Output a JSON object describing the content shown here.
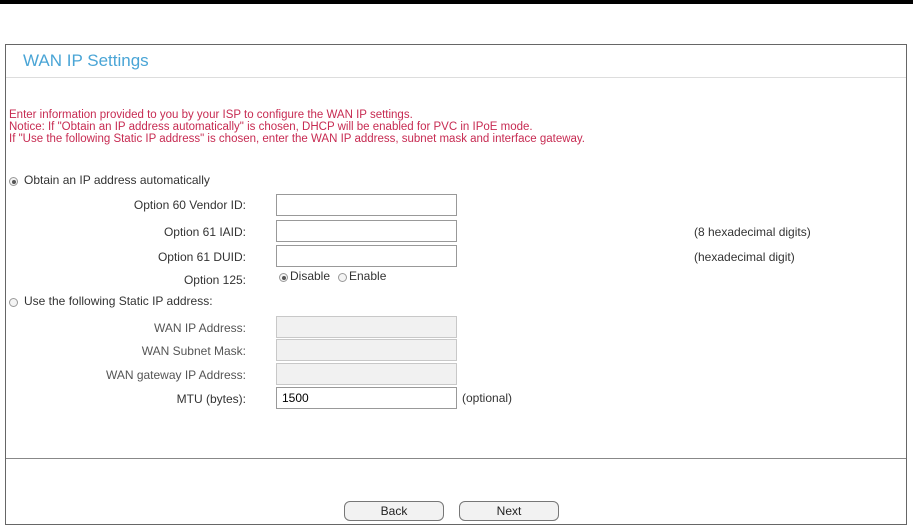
{
  "page": {
    "title": "WAN IP Settings"
  },
  "notice": {
    "line1": "Enter information provided to you by your ISP to configure the WAN IP settings.",
    "line2": "Notice: If \"Obtain an IP address automatically\" is chosen, DHCP will be enabled for PVC in IPoE mode.",
    "line3": "If \"Use the following Static IP address\" is chosen, enter the WAN IP address, subnet mask and interface gateway."
  },
  "mode": {
    "auto_label": "Obtain an IP address automatically",
    "auto_selected": true,
    "static_label": "Use the following Static IP address:",
    "static_selected": false
  },
  "auto_fields": {
    "option60_label": "Option 60 Vendor ID:",
    "option60_value": "",
    "option61_iaid_label": "Option 61 IAID:",
    "option61_iaid_value": "",
    "option61_iaid_hint": "(8 hexadecimal digits)",
    "option61_duid_label": "Option 61 DUID:",
    "option61_duid_value": "",
    "option61_duid_hint": "(hexadecimal digit)",
    "option125_label": "Option 125:",
    "option125_disable": "Disable",
    "option125_enable": "Enable",
    "option125_selected": "Disable"
  },
  "static_fields": {
    "wan_ip_label": "WAN IP Address:",
    "wan_ip_value": "",
    "subnet_label": "WAN Subnet Mask:",
    "subnet_value": "",
    "gateway_label": "WAN gateway IP Address:",
    "gateway_value": "",
    "mtu_label": "MTU (bytes):",
    "mtu_value": "1500",
    "mtu_hint": "(optional)"
  },
  "buttons": {
    "back": "Back",
    "next": "Next"
  }
}
